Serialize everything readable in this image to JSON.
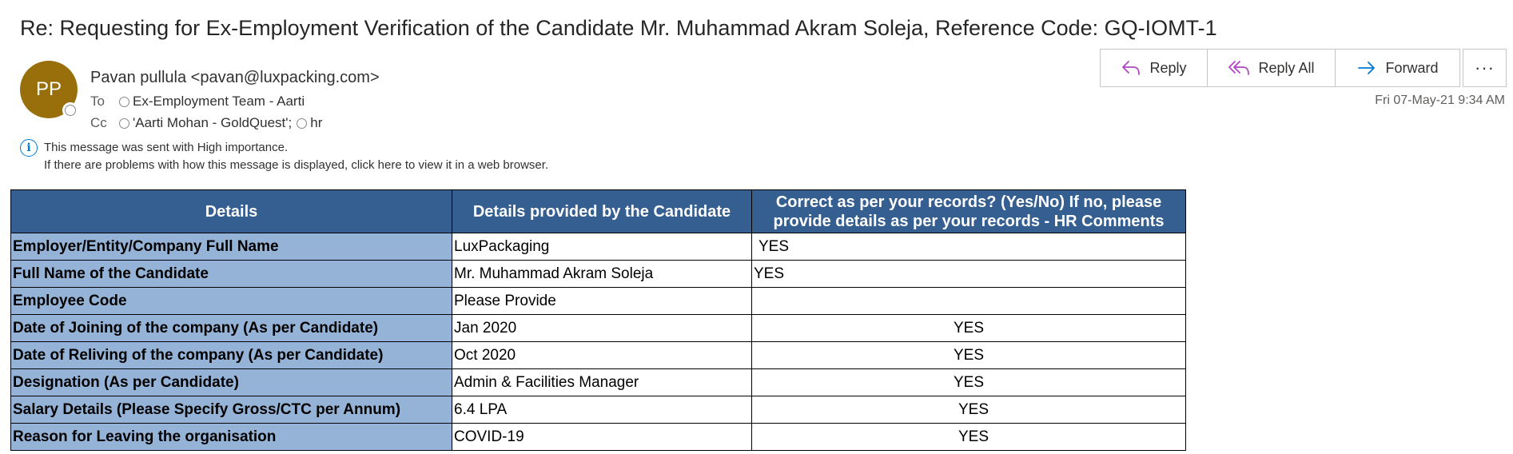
{
  "email": {
    "subject": "Re: Requesting for Ex-Employment Verification of the Candidate Mr. Muhammad Akram Soleja, Reference Code: GQ-IOMT-1",
    "avatar_initials": "PP",
    "avatar_color": "#986f0b",
    "sender": "Pavan pullula <pavan@luxpacking.com>",
    "to_label": "To",
    "to": [
      "Ex-Employment Team - Aarti"
    ],
    "cc_label": "Cc",
    "cc": [
      "'Aarti Mohan - GoldQuest';",
      "hr"
    ],
    "date": "Fri 07-May-21 9:34 AM",
    "importance_note": "This message was sent with High importance.",
    "display_note": "If there are problems with how this message is displayed, click here to view it in a web browser."
  },
  "actions": {
    "reply": "Reply",
    "reply_all": "Reply All",
    "forward": "Forward",
    "more": "···"
  },
  "table": {
    "headers": [
      "Details",
      "Details provided by the Candidate",
      "Correct as per your records? (Yes/No) If no, please provide details as per your records - HR Comments"
    ],
    "header_line1": "Correct as per your records? (Yes/No) If no, please",
    "header_line2": "provide details as per your records - HR Comments",
    "rows": [
      {
        "label": "Employer/Entity/Company Full Name",
        "candidate": "LuxPackaging",
        "hr": "YES"
      },
      {
        "label": "Full Name of the Candidate",
        "candidate": "Mr. Muhammad Akram Soleja",
        "hr": "YES"
      },
      {
        "label": "Employee Code",
        "candidate": "Please Provide",
        "hr": ""
      },
      {
        "label": "Date of Joining of the company (As per Candidate)",
        "candidate": "Jan 2020",
        "hr": "YES"
      },
      {
        "label": "Date of Reliving of the company (As per Candidate)",
        "candidate": "Oct 2020",
        "hr": "YES"
      },
      {
        "label": "Designation (As per Candidate)",
        "candidate": "Admin & Facilities Manager",
        "hr": "YES"
      },
      {
        "label": "Salary Details (Please Specify Gross/CTC per Annum)",
        "candidate": "6.4 LPA",
        "hr": "YES"
      },
      {
        "label": "Reason for Leaving the organisation",
        "candidate": "COVID-19",
        "hr": "YES"
      }
    ]
  },
  "colors": {
    "header_bg": "#355f91",
    "label_bg": "#95b3d7",
    "accent": "#0078d4",
    "reply_all_icon": "#b146c2"
  }
}
